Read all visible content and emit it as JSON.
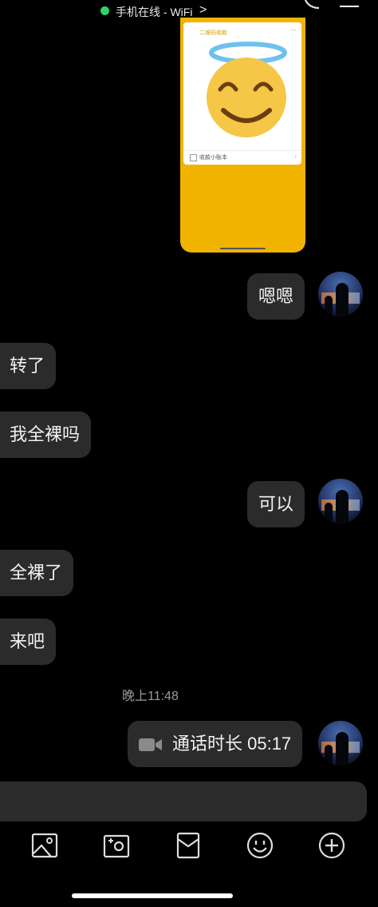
{
  "status_bar": {
    "online_text": "手机在线 - WiFi",
    "chevron": ">",
    "accent_color": "#2bd36b"
  },
  "image_message": {
    "sheet_title": "二维码收款",
    "sheet_row_label": "收款小账本",
    "emoji": "smiling-face-with-halo"
  },
  "messages": [
    {
      "side": "right",
      "text": "嗯嗯"
    },
    {
      "side": "left",
      "text": "转了"
    },
    {
      "side": "left",
      "text": "我全裸吗"
    },
    {
      "side": "right",
      "text": "可以"
    },
    {
      "side": "left",
      "text": "全裸了"
    },
    {
      "side": "left",
      "text": "来吧"
    }
  ],
  "timestamp": "晚上11:48",
  "call_message": {
    "text": "通话时长 05:17",
    "icon": "video-camera-icon"
  },
  "toolbar": [
    {
      "icon": "image-icon"
    },
    {
      "icon": "camera-icon"
    },
    {
      "icon": "red-packet-icon"
    },
    {
      "icon": "emoji-icon"
    },
    {
      "icon": "plus-icon"
    }
  ]
}
